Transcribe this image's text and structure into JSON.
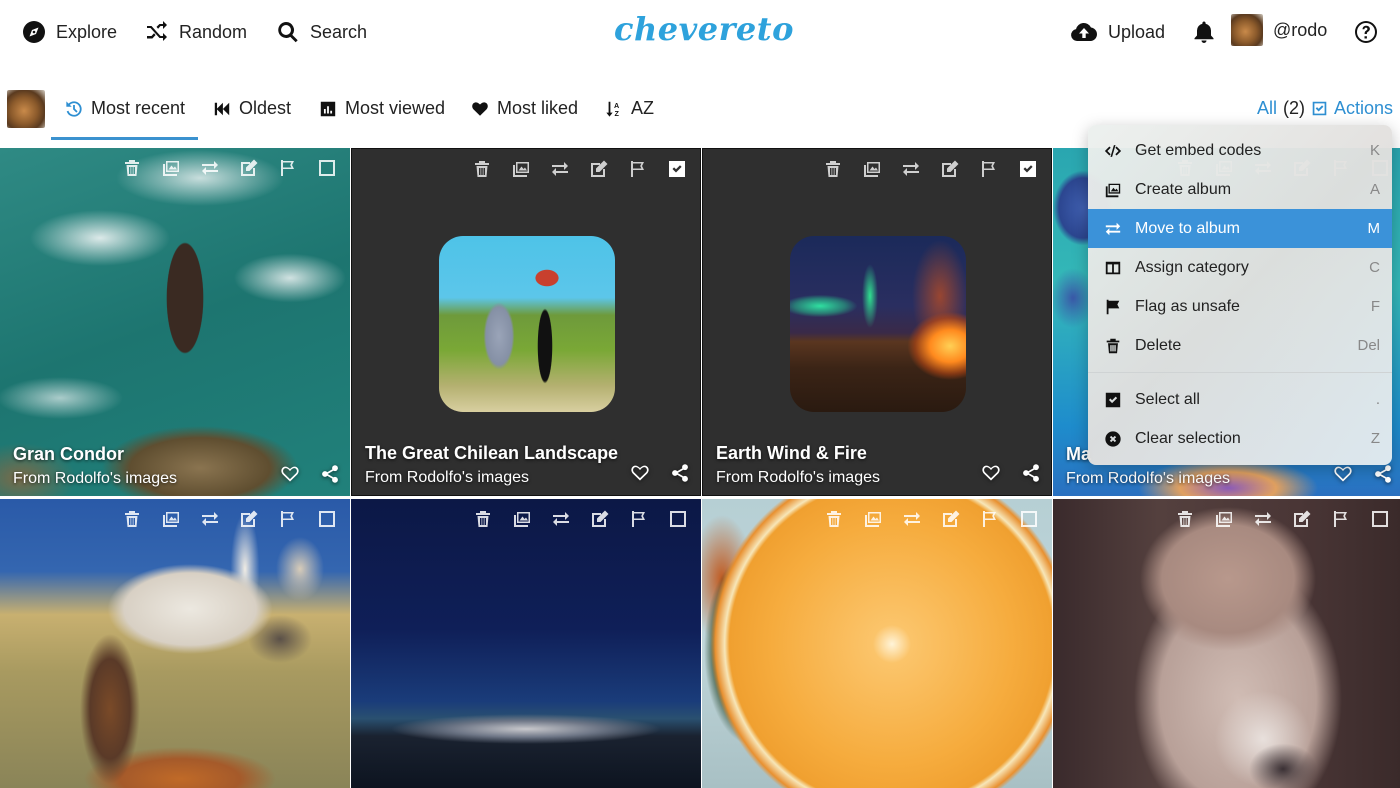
{
  "topbar": {
    "explore": "Explore",
    "random": "Random",
    "search": "Search",
    "logo": "chevereto",
    "upload": "Upload",
    "username": "@rodo"
  },
  "subbar": {
    "tabs": [
      {
        "label": "Most recent",
        "icon": "history-icon",
        "active": true
      },
      {
        "label": "Oldest",
        "icon": "backward-icon"
      },
      {
        "label": "Most viewed",
        "icon": "chart-bar-icon"
      },
      {
        "label": "Most liked",
        "icon": "heart-icon"
      },
      {
        "label": "AZ",
        "icon": "sort-alpha-icon"
      }
    ],
    "select_all": "All",
    "selected_count": "(2)",
    "actions": "Actions"
  },
  "tiles": [
    {
      "title": "Gran Condor",
      "from": "From Rodolfo's images",
      "selected": false
    },
    {
      "title": "The Great Chilean Landscape",
      "from": "From Rodolfo's images",
      "selected": true
    },
    {
      "title": "Earth Wind & Fire",
      "from": "From Rodolfo's images",
      "selected": true
    },
    {
      "title": "Ma",
      "from": "From Rodolfo's images",
      "selected": false
    },
    {
      "title": "",
      "from": "",
      "selected": false
    },
    {
      "title": "",
      "from": "",
      "selected": false
    },
    {
      "title": "",
      "from": "",
      "selected": false
    },
    {
      "title": "",
      "from": "",
      "selected": false
    }
  ],
  "menu": {
    "items": [
      {
        "label": "Get embed codes",
        "key": "K",
        "icon": "code-icon"
      },
      {
        "label": "Create album",
        "key": "A",
        "icon": "images-icon"
      },
      {
        "label": "Move to album",
        "key": "M",
        "icon": "exchange-icon",
        "highlight": true
      },
      {
        "label": "Assign category",
        "key": "C",
        "icon": "columns-icon"
      },
      {
        "label": "Flag as unsafe",
        "key": "F",
        "icon": "flag-icon"
      },
      {
        "label": "Delete",
        "key": "Del",
        "icon": "trash-icon"
      },
      {
        "label": "Select all",
        "key": ".",
        "icon": "check-square-icon"
      },
      {
        "label": "Clear selection",
        "key": "Z",
        "icon": "times-circle-icon"
      }
    ]
  },
  "colors": {
    "brand": "#2ea2dc",
    "accent": "#3b92d9",
    "tile_dark": "#2f2f2f"
  }
}
